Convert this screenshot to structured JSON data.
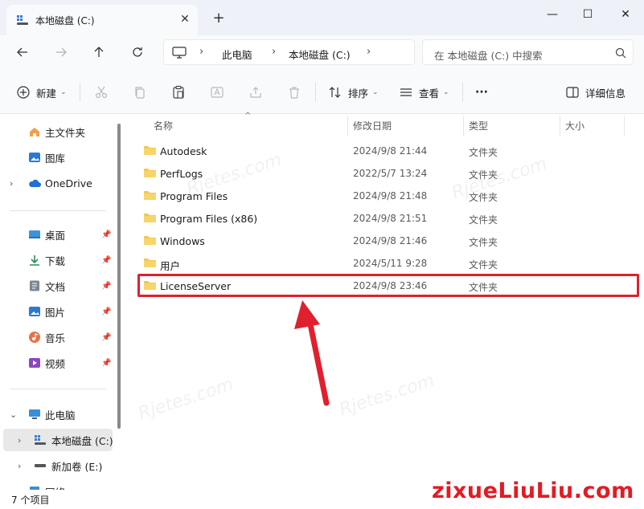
{
  "window": {
    "tab_title": "本地磁盘 (C:)",
    "tab_close": "✕",
    "new_tab": "+",
    "minimize": "—",
    "maximize": "☐",
    "close": "✕"
  },
  "address": {
    "crumbs": [
      "此电脑",
      "本地磁盘 (C:)"
    ],
    "separator": "›",
    "search_placeholder": "在 本地磁盘 (C:) 中搜索"
  },
  "toolbar": {
    "new_label": "新建",
    "sort_label": "排序",
    "view_label": "查看",
    "more_label": "···",
    "details_label": "详细信息"
  },
  "sidebar": {
    "items": [
      {
        "label": "主文件夹"
      },
      {
        "label": "图库"
      },
      {
        "label": "OneDrive"
      },
      {
        "label": "桌面"
      },
      {
        "label": "下载"
      },
      {
        "label": "文档"
      },
      {
        "label": "图片"
      },
      {
        "label": "音乐"
      },
      {
        "label": "视频"
      },
      {
        "label": "此电脑"
      },
      {
        "label": "本地磁盘 (C:)"
      },
      {
        "label": "新加卷 (E:)"
      },
      {
        "label": "网络"
      }
    ]
  },
  "columns": {
    "name": "名称",
    "date": "修改日期",
    "type": "类型",
    "size": "大小"
  },
  "files": [
    {
      "name": "Autodesk",
      "date": "2024/9/8 21:44",
      "type": "文件夹"
    },
    {
      "name": "PerfLogs",
      "date": "2022/5/7 13:24",
      "type": "文件夹"
    },
    {
      "name": "Program Files",
      "date": "2024/9/8 21:48",
      "type": "文件夹"
    },
    {
      "name": "Program Files (x86)",
      "date": "2024/9/8 21:51",
      "type": "文件夹"
    },
    {
      "name": "Windows",
      "date": "2024/9/8 21:46",
      "type": "文件夹"
    },
    {
      "name": "用户",
      "date": "2024/5/11 9:28",
      "type": "文件夹"
    },
    {
      "name": "LicenseServer",
      "date": "2024/9/8 23:46",
      "type": "文件夹"
    }
  ],
  "status": {
    "item_count": "7 个项目"
  },
  "watermark": {
    "text": "zixueLiuLiu.com"
  },
  "colors": {
    "folder": "#f2c94c",
    "highlight": "#e0202e",
    "accent": "#0067c0"
  }
}
